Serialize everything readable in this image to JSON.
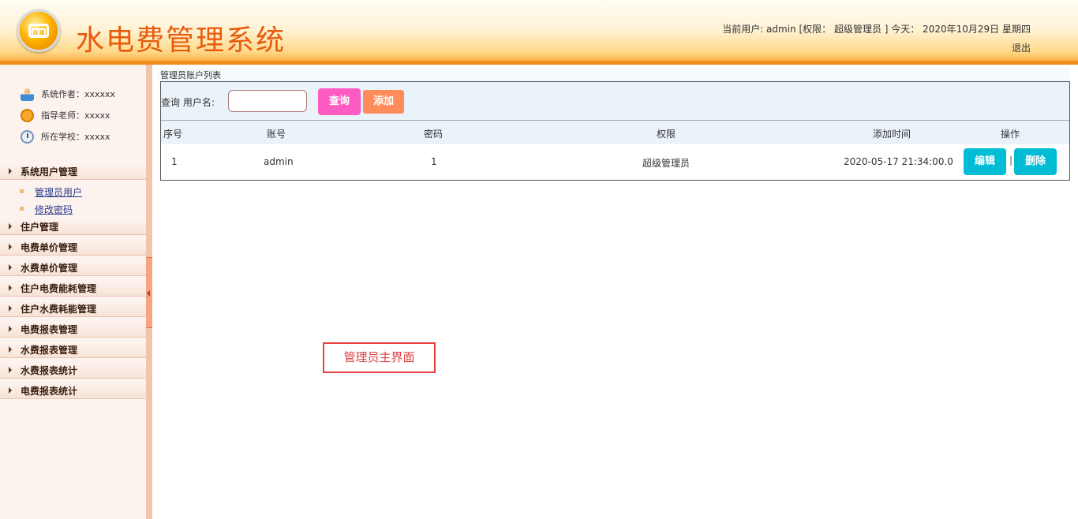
{
  "header": {
    "title": "水电费管理系统",
    "userinfo": "当前用户: admin [权限： 超级管理员 ] 今天： 2020年10月29日 星期四",
    "logout": "退出"
  },
  "sidebar": {
    "info": [
      {
        "text": "系统作者：xxxxxx",
        "icon": "user-icon"
      },
      {
        "text": "指导老师：xxxxx",
        "icon": "alarm-clock-icon"
      },
      {
        "text": "所在学校：xxxxx",
        "icon": "clock-icon"
      }
    ],
    "groups": [
      {
        "label": "系统用户管理"
      },
      {
        "label": "住户管理"
      },
      {
        "label": "电费单价管理"
      },
      {
        "label": "水费单价管理"
      },
      {
        "label": "住户电费能耗管理"
      },
      {
        "label": "住户水费耗能管理"
      },
      {
        "label": "电费报表管理"
      },
      {
        "label": "水费报表管理"
      },
      {
        "label": "水费报表统计"
      },
      {
        "label": "电费报表统计"
      }
    ],
    "subitems": [
      {
        "label": "管理员用户"
      },
      {
        "label": "修改密码"
      }
    ]
  },
  "main": {
    "crumb": "管理员账户列表",
    "search": {
      "label": "查询 用户名:",
      "value": "",
      "query_label": "查询",
      "add_label": "添加"
    },
    "columns": [
      "序号",
      "账号",
      "密码",
      "权限",
      "添加时间",
      "操作"
    ],
    "rows": [
      {
        "id": "1",
        "account": "admin",
        "password": "1",
        "role": "超级管理员",
        "time": "2020-05-17 21:34:00.0",
        "edit": "编辑",
        "sep": "|",
        "delete": "删除"
      }
    ]
  },
  "annotation": "管理员主界面",
  "colors": {
    "accent": "#f08c1f",
    "title": "#e85b0c",
    "query_button": "#ff5cc3",
    "add_button": "#ff8c5a",
    "op_button": "#00bcd4"
  }
}
